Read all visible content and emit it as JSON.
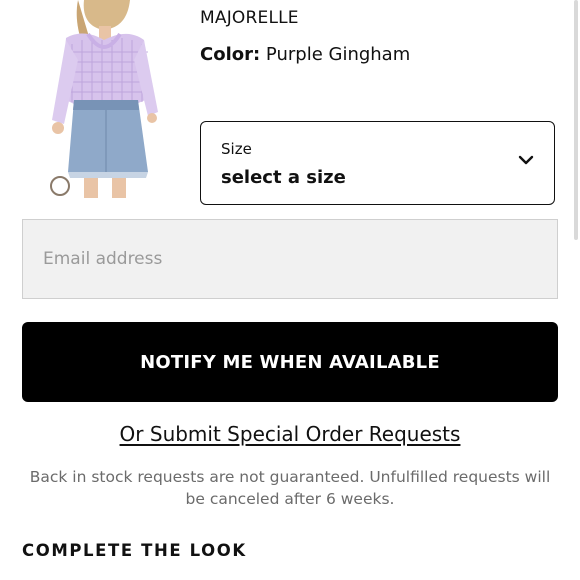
{
  "product": {
    "brand": "MAJORELLE",
    "color_label": "Color:",
    "color_value": "Purple Gingham"
  },
  "size_select": {
    "label": "Size",
    "value": "select a size",
    "icon": "chevron-down-icon"
  },
  "email": {
    "placeholder": "Email address",
    "value": ""
  },
  "notify_button": {
    "label": "NOTIFY ME WHEN AVAILABLE"
  },
  "special_order_link": {
    "label": "Or Submit Special Order Requests"
  },
  "disclaimer": "Back in stock requests are not guaranteed. Unfulfilled requests will be canceled after 6 weeks.",
  "section_heading": "COMPLETE THE LOOK",
  "colors": {
    "primary": "#000000",
    "input_bg": "#f1f1f1",
    "muted_text": "#6b6b6b",
    "placeholder": "#9a9a9a"
  }
}
